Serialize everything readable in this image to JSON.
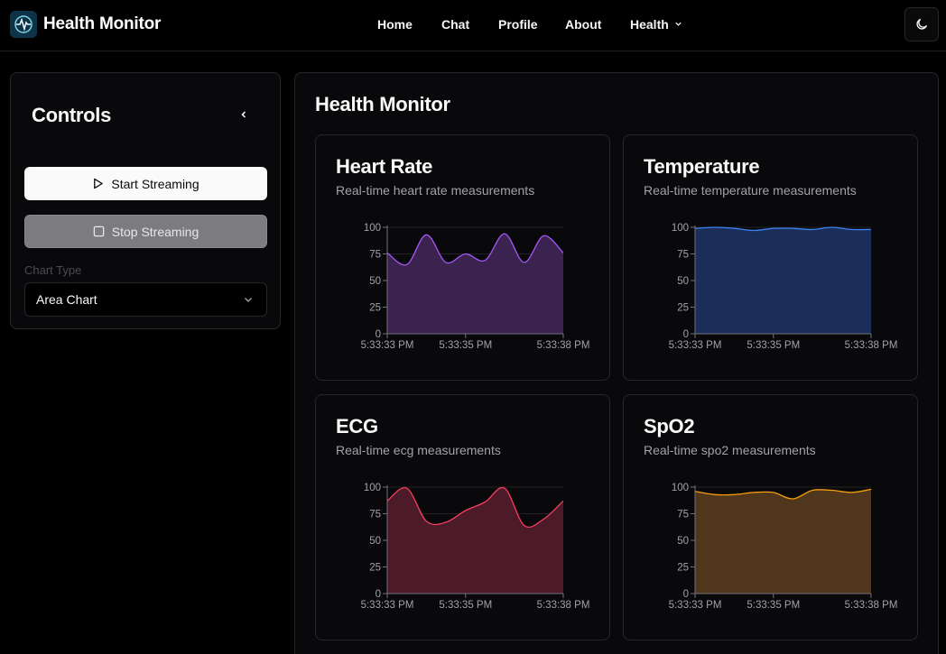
{
  "header": {
    "app_title": "Health Monitor",
    "nav": [
      "Home",
      "Chat",
      "Profile",
      "About",
      "Health"
    ]
  },
  "sidebar": {
    "title": "Controls",
    "start_label": "Start Streaming",
    "stop_label": "Stop Streaming",
    "chart_type_label": "Chart Type",
    "chart_type_value": "Area Chart"
  },
  "main": {
    "title": "Health Monitor",
    "cards": [
      {
        "title": "Heart Rate",
        "description": "Real-time heart rate measurements"
      },
      {
        "title": "Temperature",
        "description": "Real-time temperature measurements"
      },
      {
        "title": "ECG",
        "description": "Real-time ecg measurements"
      },
      {
        "title": "SpO2",
        "description": "Real-time spo2 measurements"
      }
    ]
  },
  "chart_data": [
    {
      "type": "area",
      "x": [
        "5:33:33 PM",
        "",
        "",
        "",
        "",
        "5:33:35 PM",
        "",
        "",
        "",
        "",
        "5:33:38 PM"
      ],
      "x_ticks": [
        "5:33:33 PM",
        "5:33:35 PM",
        "5:33:38 PM"
      ],
      "values": [
        76,
        65,
        93,
        67,
        75,
        69,
        94,
        67,
        92,
        76
      ],
      "ylim": [
        0,
        100
      ],
      "y_ticks": [
        0,
        25,
        50,
        75,
        100
      ],
      "color": "#a855f7",
      "fill": "#3b2350"
    },
    {
      "type": "area",
      "x_ticks": [
        "5:33:33 PM",
        "5:33:35 PM",
        "5:33:38 PM"
      ],
      "values": [
        99,
        100,
        99,
        97,
        99,
        99,
        98,
        100,
        98,
        98
      ],
      "ylim": [
        0,
        100
      ],
      "y_ticks": [
        0,
        25,
        50,
        75,
        100
      ],
      "color": "#3b82f6",
      "fill": "#1b2e5a"
    },
    {
      "type": "area",
      "x_ticks": [
        "5:33:33 PM",
        "5:33:35 PM",
        "5:33:38 PM"
      ],
      "values": [
        87,
        99,
        68,
        67,
        78,
        86,
        99,
        64,
        70,
        87
      ],
      "ylim": [
        0,
        100
      ],
      "y_ticks": [
        0,
        25,
        50,
        75,
        100
      ],
      "color": "#f43f5e",
      "fill": "#4d1a2a"
    },
    {
      "type": "area",
      "x_ticks": [
        "5:33:33 PM",
        "5:33:35 PM",
        "5:33:38 PM"
      ],
      "values": [
        96,
        93,
        93,
        95,
        95,
        89,
        97,
        97,
        95,
        98
      ],
      "ylim": [
        0,
        100
      ],
      "y_ticks": [
        0,
        25,
        50,
        75,
        100
      ],
      "color": "#f59e0b",
      "fill": "#50361d"
    }
  ]
}
